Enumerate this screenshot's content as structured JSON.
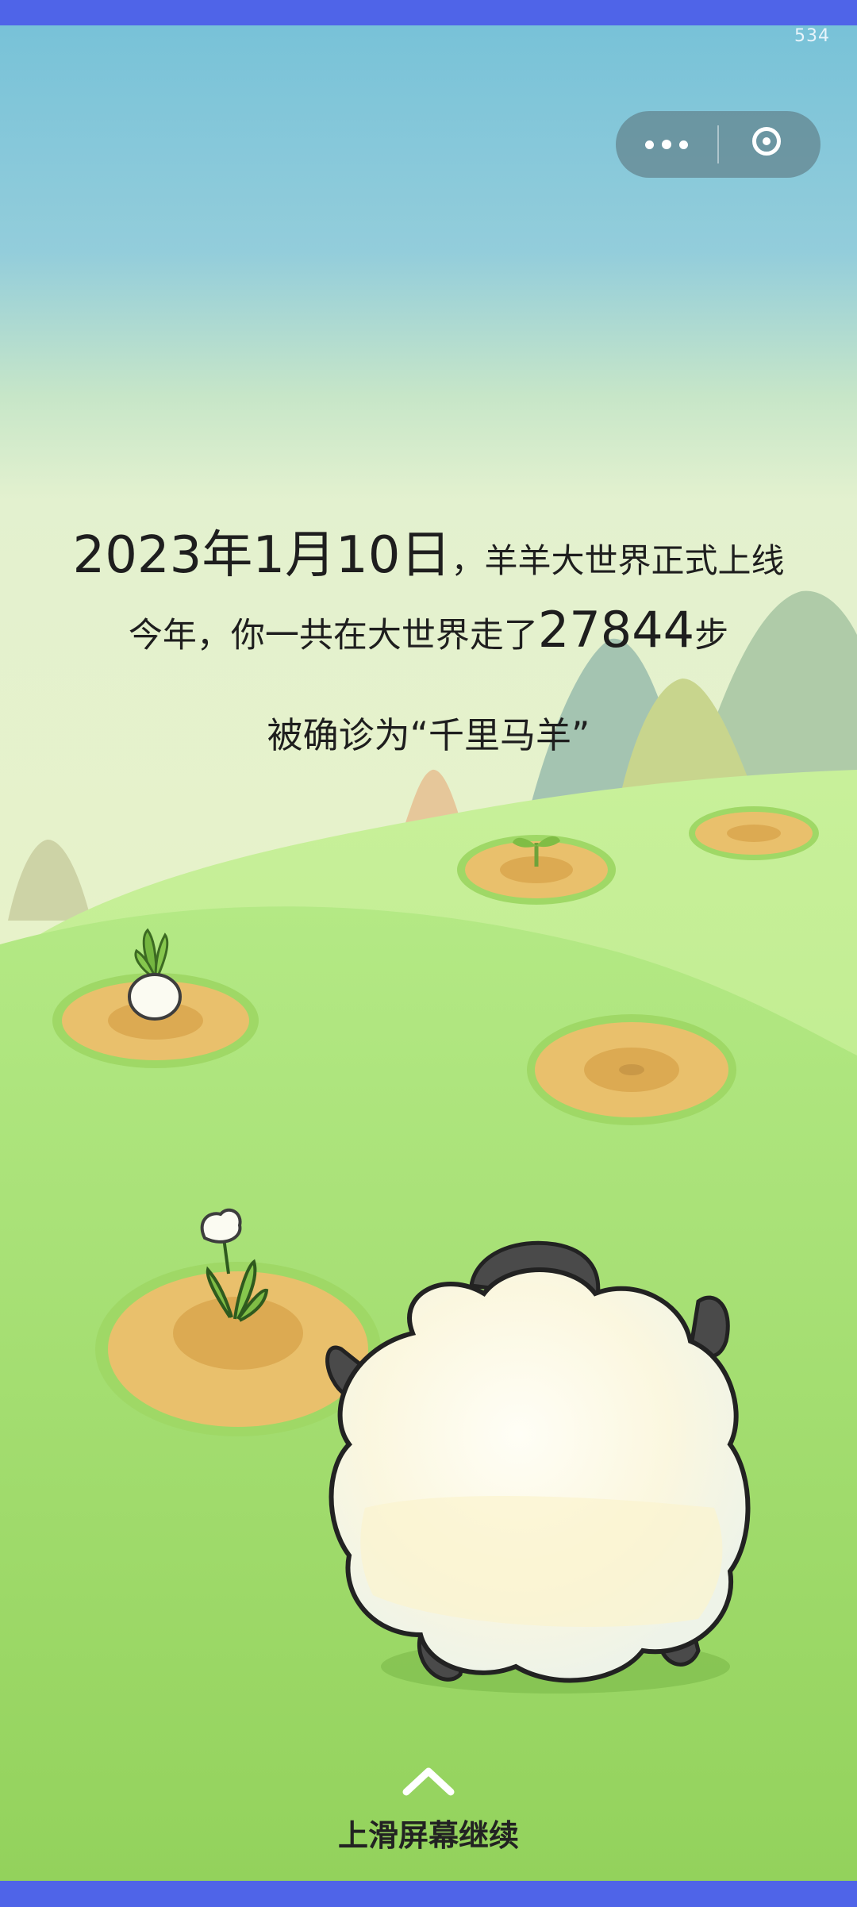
{
  "status": {
    "top_right_number": "534"
  },
  "capsule": {
    "more_icon": "more-dots-icon",
    "close_icon": "target-close-icon"
  },
  "headline": {
    "line1_date": "2023年1月10日",
    "line1_rest": "，羊羊大世界正式上线",
    "line2_prefix": "今年，你一共在大世界走了",
    "line2_steps": "27844",
    "line2_suffix": "步",
    "line3": "被确诊为“千里马羊”"
  },
  "footer": {
    "swipe_label": "上滑屏幕继续",
    "swipe_icon": "chevron-up-icon"
  },
  "colors": {
    "frame": "#4f64e8",
    "sky_top": "#7cc3d9",
    "grass": "#a9e277",
    "dirt": "#e9c06c"
  }
}
